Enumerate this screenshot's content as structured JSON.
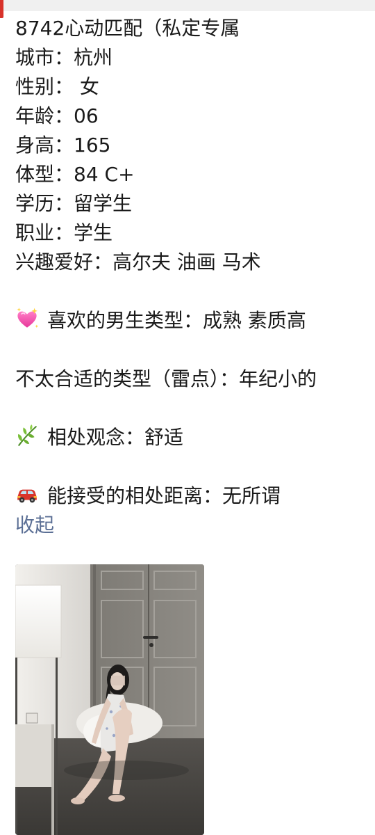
{
  "post": {
    "title": "8742心动匹配（私定专属",
    "fields": {
      "city": "城市：杭州",
      "gender": "性别： 女",
      "age": "年龄：06",
      "height": "身高：165",
      "body_type": "体型：84 C+",
      "education": "学历：留学生",
      "occupation": "职业：学生",
      "hobbies": "兴趣爱好：高尔夫 油画 马术"
    },
    "preferred_type": "喜欢的男生类型：成熟 素质高",
    "dealbreakers": "不太合适的类型（雷点）：年纪小的",
    "relationship_view": "相处观念：舒适",
    "distance": "能接受的相处距离：无所谓",
    "collapse_label": "收起"
  },
  "icons": {
    "preferred_type": "sparkling-heart-icon",
    "relationship_view": "herb-leaf-icon",
    "distance": "red-car-icon"
  },
  "colors": {
    "text": "#1a1a1a",
    "link": "#5b6f95",
    "top_accent": "#d8322a"
  }
}
